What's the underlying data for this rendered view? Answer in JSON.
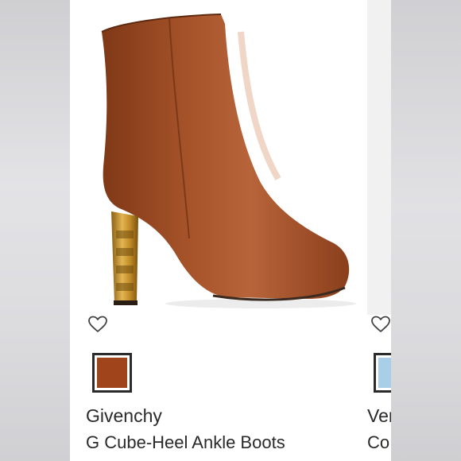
{
  "product": {
    "brand": "Givenchy",
    "name": "G Cube-Heel Ankle Boots",
    "swatch_color": "#a0441c",
    "favorite_icon": "heart-outline-icon"
  },
  "neighbor_product": {
    "brand_partial": "Ver",
    "name_partial": "Co",
    "swatch_color": "#a9cfe8",
    "favorite_icon": "heart-outline-icon"
  },
  "colors": {
    "leather": "#9a4a22",
    "gold": "#c9982f",
    "text": "#2a2a2a"
  }
}
